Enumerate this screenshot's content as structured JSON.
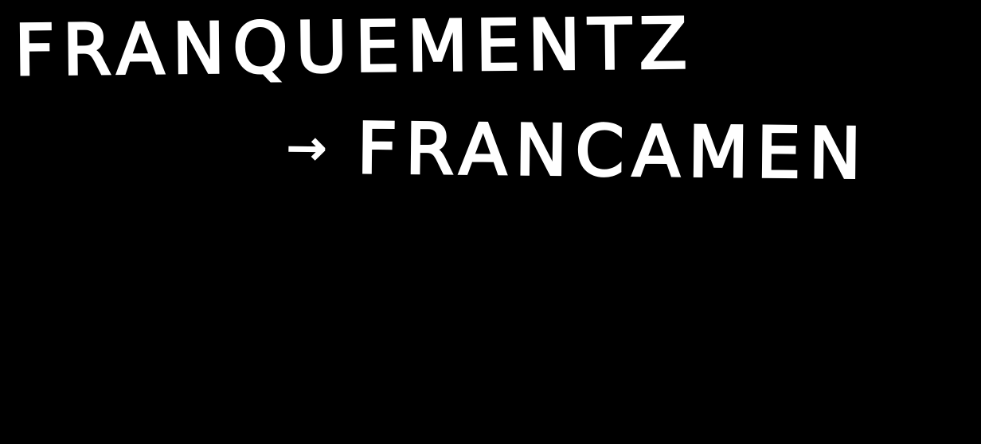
{
  "background_color": "#000000",
  "ink_color": "#ffffff",
  "lines": {
    "first": "FRANQUEMENTZ",
    "arrow": "→",
    "second": "FRANCAMEN"
  }
}
